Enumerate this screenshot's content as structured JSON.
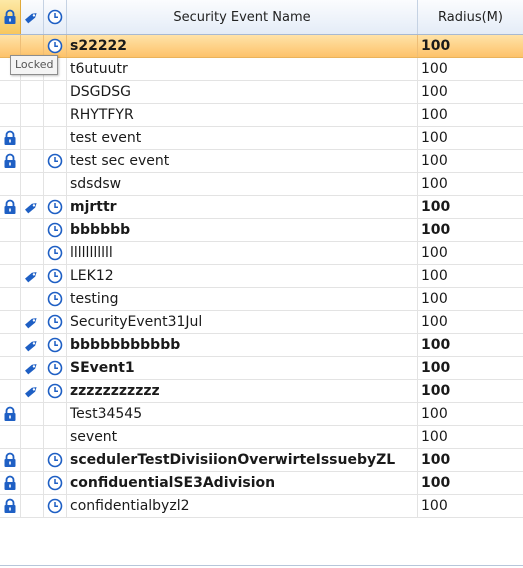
{
  "columns": {
    "lock_icon": "lock-icon",
    "tag_icon": "tag-icon",
    "clock_icon": "clock-icon",
    "name": "Security Event Name",
    "radius": "Radius(M)"
  },
  "tooltip": "Locked",
  "colors": {
    "selected": "#fdc26a",
    "icon_blue": "#1e5fc4"
  },
  "rows": [
    {
      "name": "s22222",
      "radius": "100",
      "locked": false,
      "tagged": false,
      "scheduled": true,
      "bold": true,
      "selected": true
    },
    {
      "name": "t6utuutr",
      "radius": "100",
      "locked": false,
      "tagged": false,
      "scheduled": false,
      "bold": false,
      "selected": false
    },
    {
      "name": "DSGDSG",
      "radius": "100",
      "locked": false,
      "tagged": false,
      "scheduled": false,
      "bold": false,
      "selected": false
    },
    {
      "name": "RHYTFYR",
      "radius": "100",
      "locked": false,
      "tagged": false,
      "scheduled": false,
      "bold": false,
      "selected": false
    },
    {
      "name": "test event",
      "radius": "100",
      "locked": true,
      "tagged": false,
      "scheduled": false,
      "bold": false,
      "selected": false
    },
    {
      "name": "test sec event",
      "radius": "100",
      "locked": true,
      "tagged": false,
      "scheduled": true,
      "bold": false,
      "selected": false
    },
    {
      "name": "sdsdsw",
      "radius": "100",
      "locked": false,
      "tagged": false,
      "scheduled": false,
      "bold": false,
      "selected": false
    },
    {
      "name": "mjrttr",
      "radius": "100",
      "locked": true,
      "tagged": true,
      "scheduled": true,
      "bold": true,
      "selected": false
    },
    {
      "name": "bbbbbb",
      "radius": "100",
      "locked": false,
      "tagged": false,
      "scheduled": true,
      "bold": true,
      "selected": false
    },
    {
      "name": "lllllllllll",
      "radius": "100",
      "locked": false,
      "tagged": false,
      "scheduled": true,
      "bold": false,
      "selected": false
    },
    {
      "name": "LEK12",
      "radius": "100",
      "locked": false,
      "tagged": true,
      "scheduled": true,
      "bold": false,
      "selected": false
    },
    {
      "name": "testing",
      "radius": "100",
      "locked": false,
      "tagged": false,
      "scheduled": true,
      "bold": false,
      "selected": false
    },
    {
      "name": "SecurityEvent31Jul",
      "radius": "100",
      "locked": false,
      "tagged": true,
      "scheduled": true,
      "bold": false,
      "selected": false
    },
    {
      "name": "bbbbbbbbbbb",
      "radius": "100",
      "locked": false,
      "tagged": true,
      "scheduled": true,
      "bold": true,
      "selected": false
    },
    {
      "name": "SEvent1",
      "radius": "100",
      "locked": false,
      "tagged": true,
      "scheduled": true,
      "bold": true,
      "selected": false
    },
    {
      "name": "zzzzzzzzzzz",
      "radius": "100",
      "locked": false,
      "tagged": true,
      "scheduled": true,
      "bold": true,
      "selected": false
    },
    {
      "name": "Test34545",
      "radius": "100",
      "locked": true,
      "tagged": false,
      "scheduled": false,
      "bold": false,
      "selected": false
    },
    {
      "name": "sevent",
      "radius": "100",
      "locked": false,
      "tagged": false,
      "scheduled": false,
      "bold": false,
      "selected": false
    },
    {
      "name": "scedulerTestDivisiionOverwirteIssuebyZL",
      "radius": "100",
      "locked": true,
      "tagged": false,
      "scheduled": true,
      "bold": true,
      "selected": false
    },
    {
      "name": "confiduentialSE3Adivision",
      "radius": "100",
      "locked": true,
      "tagged": false,
      "scheduled": true,
      "bold": true,
      "selected": false
    },
    {
      "name": "confidentialbyzl2",
      "radius": "100",
      "locked": true,
      "tagged": false,
      "scheduled": true,
      "bold": false,
      "selected": false
    }
  ]
}
